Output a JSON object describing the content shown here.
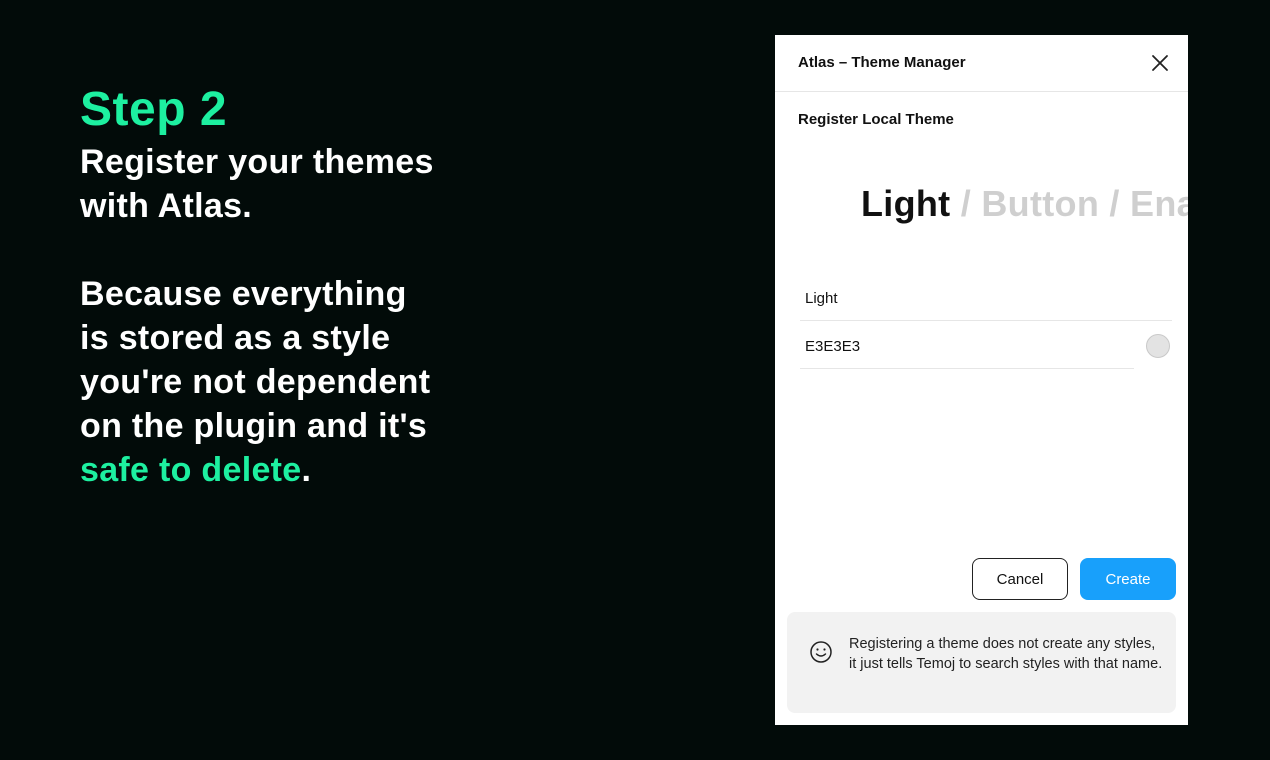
{
  "promo": {
    "step_title": "Step 2",
    "heading_lines": [
      "Register your themes",
      "with Atlas."
    ],
    "body_lines": [
      "Because everything",
      "is stored as a style",
      "you're not dependent",
      "on the plugin and it's"
    ],
    "highlight": "safe to delete",
    "trailing": "."
  },
  "window": {
    "title": "Atlas – Theme Manager",
    "close_icon": "close-icon",
    "section_title": "Register Local Theme",
    "preview": {
      "main": "Light",
      "rest": " / Button / Enab"
    },
    "fields": {
      "theme_name": "Light",
      "theme_color": "E3E3E3"
    },
    "swatch_color": "#E3E3E3",
    "buttons": {
      "cancel": "Cancel",
      "create": "Create"
    },
    "notice": {
      "icon": "smiley-icon",
      "text": "Registering a theme does not create any styles, it just tells Temoj to search styles with that name."
    }
  },
  "colors": {
    "background": "#020B09",
    "accent": "#1DF0A0",
    "primary_button": "#18A0FB"
  }
}
